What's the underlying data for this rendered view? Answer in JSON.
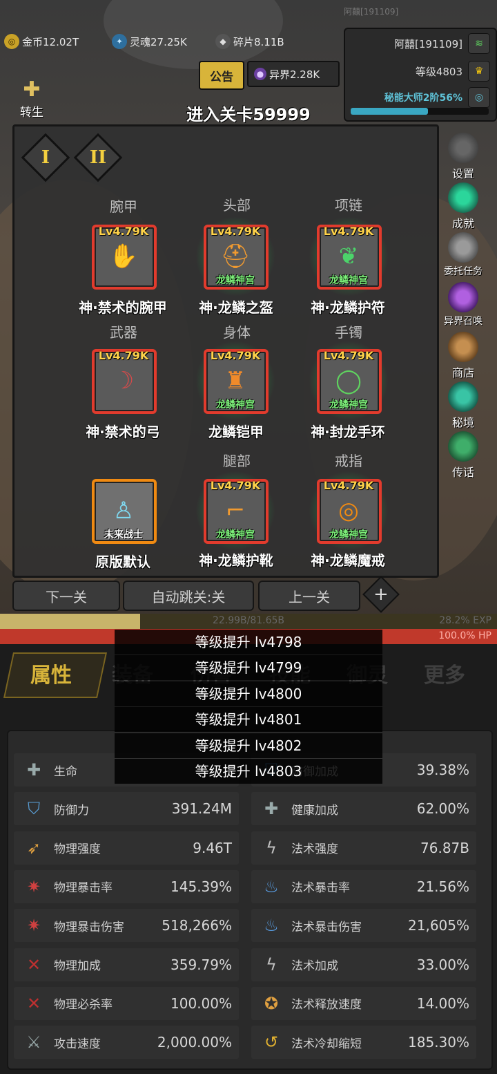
{
  "top_hint": "阿囍[191109]",
  "currencies": [
    {
      "icon": "gold-coin-icon",
      "label": "金币12.02T"
    },
    {
      "icon": "soul-icon",
      "label": "灵魂27.25K"
    },
    {
      "icon": "shard-icon",
      "label": "碎片8.11B"
    },
    {
      "icon": "otherworld-icon",
      "label": "异界2.28K"
    }
  ],
  "notice_label": "公告",
  "rebirth_label": "转生",
  "player": {
    "name": "阿囍[191109]",
    "level": "等级4803",
    "mastery": "秘能大师2阶56%",
    "mastery_progress": 0.56
  },
  "stage_title": "进入关卡59999",
  "set_tabs": [
    "I",
    "II"
  ],
  "equipment": [
    {
      "slot": "腕甲",
      "level": "Lv4.79K",
      "badge": "",
      "name": "神·禁术的腕甲",
      "icon": "bracer-icon",
      "glow": false
    },
    {
      "slot": "头部",
      "level": "Lv4.79K",
      "badge": "龙鳞神宫",
      "name": "神·龙鳞之盔",
      "icon": "helmet-icon",
      "glow": true
    },
    {
      "slot": "项链",
      "level": "Lv4.79K",
      "badge": "龙鳞神宫",
      "name": "神·龙鳞护符",
      "icon": "necklace-icon",
      "glow": true
    },
    {
      "slot": "武器",
      "level": "Lv4.79K",
      "badge": "",
      "name": "神·禁术的弓",
      "icon": "bow-icon",
      "glow": false
    },
    {
      "slot": "身体",
      "level": "Lv4.79K",
      "badge": "龙鳞神宫",
      "name": "龙鳞铠甲",
      "icon": "armor-icon",
      "glow": true
    },
    {
      "slot": "手镯",
      "level": "Lv4.79K",
      "badge": "龙鳞神宫",
      "name": "神·封龙手环",
      "icon": "bracelet-icon",
      "glow": true
    },
    {
      "slot": "",
      "level": "",
      "badge": "未来战士",
      "name": "原版默认",
      "icon": "costume-icon",
      "glow": false
    },
    {
      "slot": "腿部",
      "level": "Lv4.79K",
      "badge": "龙鳞神宫",
      "name": "神·龙鳞护靴",
      "icon": "boots-icon",
      "glow": true
    },
    {
      "slot": "戒指",
      "level": "Lv4.79K",
      "badge": "龙鳞神宫",
      "name": "神·龙鳞魔戒",
      "icon": "ring-icon",
      "glow": true
    }
  ],
  "side_menu": [
    {
      "label": "设置",
      "icon": "gear-icon"
    },
    {
      "label": "成就",
      "icon": "star-icon"
    },
    {
      "label": "委托任务",
      "icon": "scroll-icon"
    },
    {
      "label": "异界召唤",
      "icon": "portal-icon"
    },
    {
      "label": "商店",
      "icon": "bag-icon"
    },
    {
      "label": "秘境",
      "icon": "crystal-icon"
    },
    {
      "label": "传话",
      "icon": "horn-icon"
    }
  ],
  "nav_buttons": [
    "下一关",
    "自动跳关:关",
    "上一关"
  ],
  "exp_bar": {
    "text": "22.99B/81.65B",
    "percent": "28.2% EXP",
    "fill": 0.282
  },
  "hp_bar": {
    "percent": "100.0% HP"
  },
  "main_tabs": [
    "属性",
    "装备",
    "伤害",
    "技能",
    "御灵",
    "更多"
  ],
  "level_log": [
    "等级提升 lv4798",
    "等级提升 lv4799",
    "等级提升 lv4800",
    "等级提升 lv4801",
    "等级提升 lv4802",
    "等级提升 lv4803"
  ],
  "stats_left": [
    {
      "label": "生命",
      "value": "",
      "icon": "health-cross-icon"
    },
    {
      "label": "防御力",
      "value": "391.24M",
      "icon": "shield-icon"
    },
    {
      "label": "物理强度",
      "value": "9.46T",
      "icon": "blade-icon"
    },
    {
      "label": "物理暴击率",
      "value": "145.39%",
      "icon": "claw-icon"
    },
    {
      "label": "物理暴击伤害",
      "value": "518,266%",
      "icon": "claw-icon"
    },
    {
      "label": "物理加成",
      "value": "359.79%",
      "icon": "slash-icon"
    },
    {
      "label": "物理必杀率",
      "value": "100.00%",
      "icon": "slash-icon"
    },
    {
      "label": "攻击速度",
      "value": "2,000.00%",
      "icon": "sword-icon"
    }
  ],
  "stats_right": [
    {
      "label": "防御加成",
      "value": "39.38%",
      "icon": "shield-icon"
    },
    {
      "label": "健康加成",
      "value": "62.00%",
      "icon": "health-cross-icon"
    },
    {
      "label": "法术强度",
      "value": "76.87B",
      "icon": "lightning-icon"
    },
    {
      "label": "法术暴击率",
      "value": "21.56%",
      "icon": "flame-icon"
    },
    {
      "label": "法术暴击伤害",
      "value": "21,605%",
      "icon": "flame-icon"
    },
    {
      "label": "法术加成",
      "value": "33.00%",
      "icon": "lightning-icon"
    },
    {
      "label": "法术释放速度",
      "value": "14.00%",
      "icon": "badge-icon"
    },
    {
      "label": "法术冷却缩短",
      "value": "185.30%",
      "icon": "cooldown-icon"
    }
  ]
}
